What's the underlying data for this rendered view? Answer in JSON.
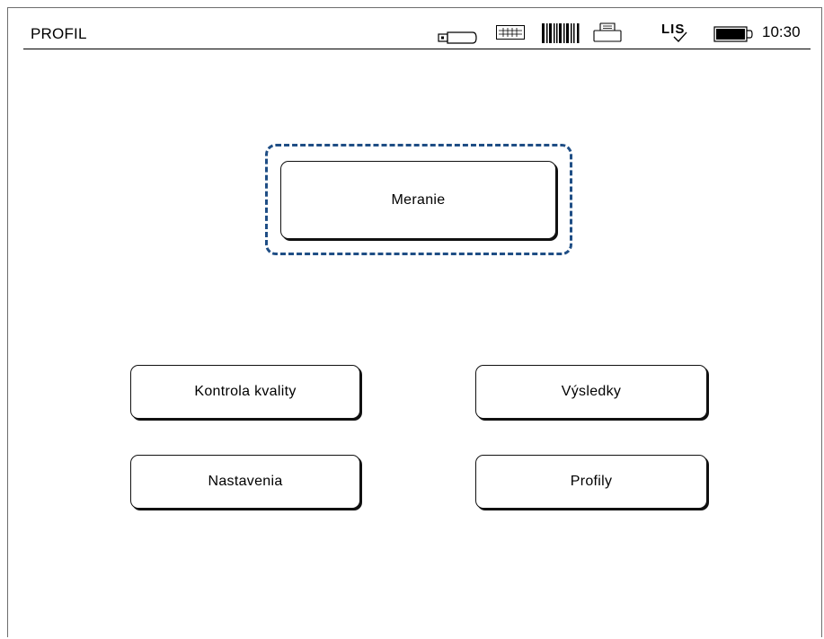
{
  "header": {
    "title": "PROFIL",
    "time": "10:30",
    "lis_label": "LIS",
    "icons": [
      "usb-icon",
      "keyboard-icon",
      "barcode-icon",
      "printer-icon",
      "lis-icon",
      "battery-icon"
    ]
  },
  "menu": {
    "primary": {
      "label": "Meranie",
      "focused": true
    },
    "buttons": [
      {
        "id": "quality-control",
        "label": "Kontrola kvality"
      },
      {
        "id": "results",
        "label": "Výsledky"
      },
      {
        "id": "settings",
        "label": "Nastavenia"
      },
      {
        "id": "profiles",
        "label": "Profily"
      }
    ]
  },
  "colors": {
    "focus": "#1f4e85",
    "border": "#111111"
  }
}
